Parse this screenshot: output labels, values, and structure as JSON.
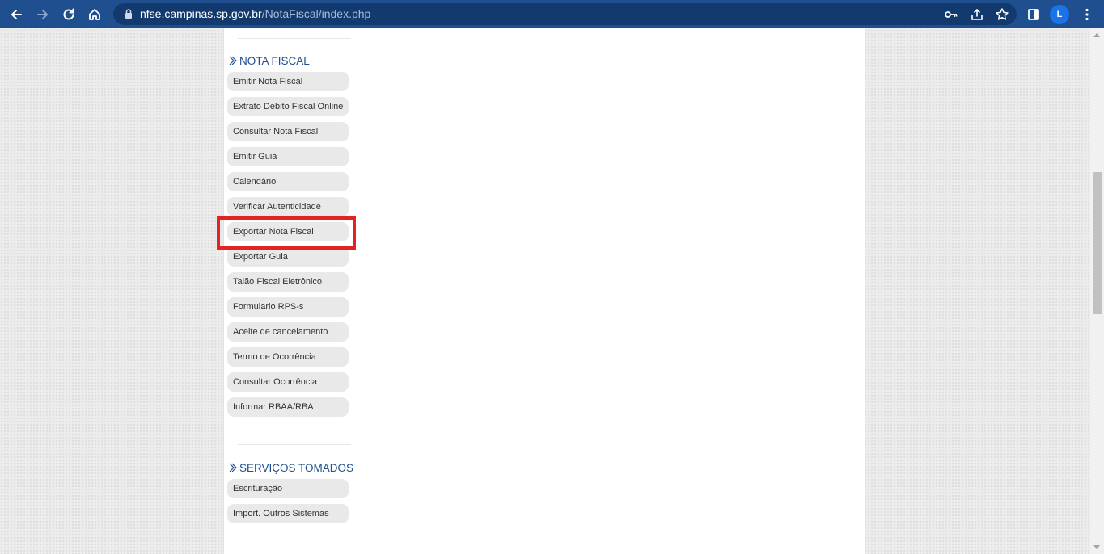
{
  "browser": {
    "url_host": "nfse.campinas.sp.gov.br",
    "url_path": "/NotaFiscal/index.php",
    "profile_initial": "L",
    "toolbar_color": "#1f4f8f"
  },
  "sidebar": {
    "sections": [
      {
        "title": "NOTA FISCAL",
        "items": [
          {
            "label": "Emitir Nota Fiscal"
          },
          {
            "label": "Extrato Debito Fiscal Online"
          },
          {
            "label": "Consultar Nota Fiscal"
          },
          {
            "label": "Emitir Guia"
          },
          {
            "label": "Calendário"
          },
          {
            "label": "Verificar Autenticidade"
          },
          {
            "label": "Exportar Nota Fiscal",
            "highlighted": true
          },
          {
            "label": "Exportar Guia"
          },
          {
            "label": "Talão Fiscal Eletrônico"
          },
          {
            "label": "Formulario RPS-s"
          },
          {
            "label": "Aceite de cancelamento"
          },
          {
            "label": "Termo de Ocorrência"
          },
          {
            "label": "Consultar Ocorrência"
          },
          {
            "label": "Informar RBAA/RBA"
          }
        ]
      },
      {
        "title": "SERVIÇOS TOMADOS",
        "items": [
          {
            "label": "Escrituração"
          },
          {
            "label": "Import. Outros Sistemas"
          }
        ]
      }
    ]
  },
  "colors": {
    "section_title": "#1f4f8f",
    "menu_item_bg": "#e9e9e9",
    "highlight_border": "#e32222"
  }
}
